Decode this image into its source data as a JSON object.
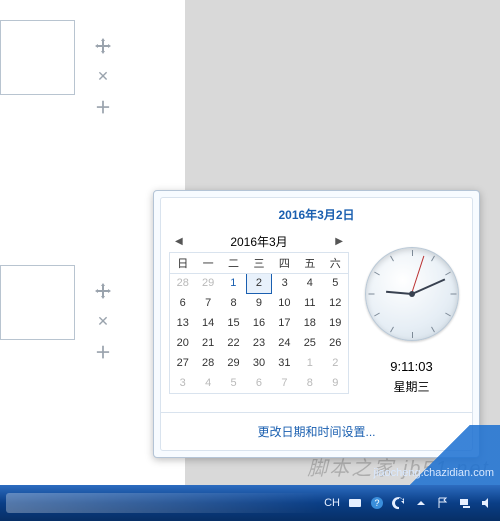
{
  "title": "2016年3月2日",
  "month_label": "2016年3月",
  "weekdays": [
    "日",
    "一",
    "二",
    "三",
    "四",
    "五",
    "六"
  ],
  "grid": [
    [
      {
        "d": "28",
        "dim": true
      },
      {
        "d": "29",
        "dim": true
      },
      {
        "d": "1",
        "today": true
      },
      {
        "d": "2",
        "sel": true
      },
      {
        "d": "3"
      },
      {
        "d": "4"
      },
      {
        "d": "5"
      }
    ],
    [
      {
        "d": "6"
      },
      {
        "d": "7"
      },
      {
        "d": "8"
      },
      {
        "d": "9"
      },
      {
        "d": "10"
      },
      {
        "d": "11"
      },
      {
        "d": "12"
      }
    ],
    [
      {
        "d": "13"
      },
      {
        "d": "14"
      },
      {
        "d": "15"
      },
      {
        "d": "16"
      },
      {
        "d": "17"
      },
      {
        "d": "18"
      },
      {
        "d": "19"
      }
    ],
    [
      {
        "d": "20"
      },
      {
        "d": "21"
      },
      {
        "d": "22"
      },
      {
        "d": "23"
      },
      {
        "d": "24"
      },
      {
        "d": "25"
      },
      {
        "d": "26"
      }
    ],
    [
      {
        "d": "27"
      },
      {
        "d": "28"
      },
      {
        "d": "29"
      },
      {
        "d": "30"
      },
      {
        "d": "31"
      },
      {
        "d": "1",
        "dim": true
      },
      {
        "d": "2",
        "dim": true
      }
    ],
    [
      {
        "d": "3",
        "dim": true
      },
      {
        "d": "4",
        "dim": true
      },
      {
        "d": "5",
        "dim": true
      },
      {
        "d": "6",
        "dim": true
      },
      {
        "d": "7",
        "dim": true
      },
      {
        "d": "8",
        "dim": true
      },
      {
        "d": "9",
        "dim": true
      }
    ]
  ],
  "nav": {
    "prev": "◀",
    "next": "▶"
  },
  "time": "9:11:03",
  "weekday": "星期三",
  "footer_link": "更改日期和时间设置...",
  "taskbar": {
    "lang": "CH"
  },
  "watermark": "脚本之家 jb51.net",
  "wm_url": "jiaocheng.chazidian.com"
}
